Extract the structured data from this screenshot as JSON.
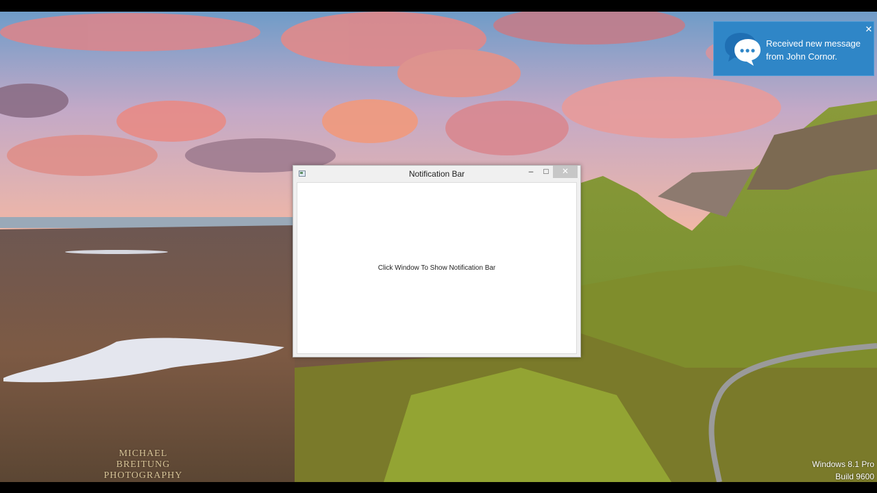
{
  "window": {
    "title": "Notification Bar",
    "minimize_glyph": "–",
    "maximize_glyph": "□",
    "close_glyph": "✕",
    "body_text": "Click Window To Show Notification Bar"
  },
  "notification": {
    "line1": "Received new message",
    "line2": "from John Cornor.",
    "close_glyph": "✕",
    "icon": "chat-bubbles-icon",
    "background": "#2f86c7"
  },
  "desktop": {
    "watermark_line1": "MICHAEL BREITUNG",
    "watermark_line2": "PHOTOGRAPHY",
    "os_line1": "Windows 8.1 Pro",
    "os_line2": "Build 9600"
  }
}
